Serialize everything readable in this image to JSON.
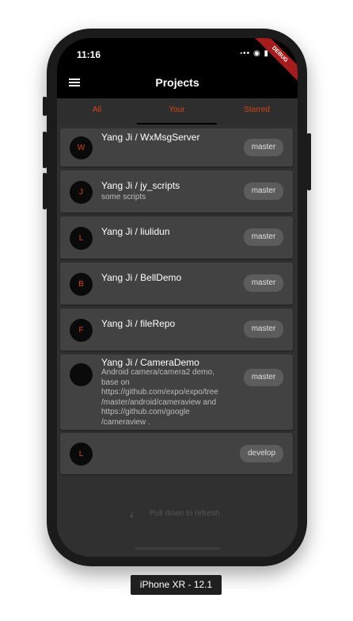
{
  "status": {
    "time": "11:16"
  },
  "debug_banner": "DEBUG",
  "appbar": {
    "title": "Projects"
  },
  "tabs": [
    {
      "label": "All"
    },
    {
      "label": "Your"
    },
    {
      "label": "Starred"
    }
  ],
  "projects": [
    {
      "avatar": "W",
      "title": "Yang Ji / WxMsgServer",
      "description": "",
      "branch": "master"
    },
    {
      "avatar": "J",
      "title": "Yang Ji / jy_scripts",
      "description": "some scripts",
      "branch": "master"
    },
    {
      "avatar": "L",
      "title": "Yang Ji / liulidun",
      "description": "",
      "branch": "master"
    },
    {
      "avatar": "B",
      "title": "Yang Ji / BellDemo",
      "description": "",
      "branch": "master"
    },
    {
      "avatar": "F",
      "title": "Yang Ji / fileRepo",
      "description": "",
      "branch": "master"
    },
    {
      "avatar": "",
      "title": "Yang Ji / CameraDemo",
      "description_lines": [
        "Android camera/camera2 demo,",
        "base on",
        "https://github.com/expo/expo/tree",
        "/master/android/cameraview and",
        "https://github.com/google",
        "/cameraview ."
      ],
      "branch": "master"
    },
    {
      "avatar": "L",
      "title": "",
      "description": "",
      "branch": "develop"
    }
  ],
  "pull_hint": "Pull down to refresh",
  "icons": {
    "menu": "hamburger-menu-icon",
    "pull": "arrow-down-icon",
    "signal": "signal-icon",
    "wifi": "wifi-icon",
    "battery": "battery-icon"
  },
  "colors": {
    "accent": "#d84315",
    "background": "#303030",
    "card": "#424242",
    "appbar": "#000000"
  },
  "device_label": "iPhone XR - 12.1"
}
